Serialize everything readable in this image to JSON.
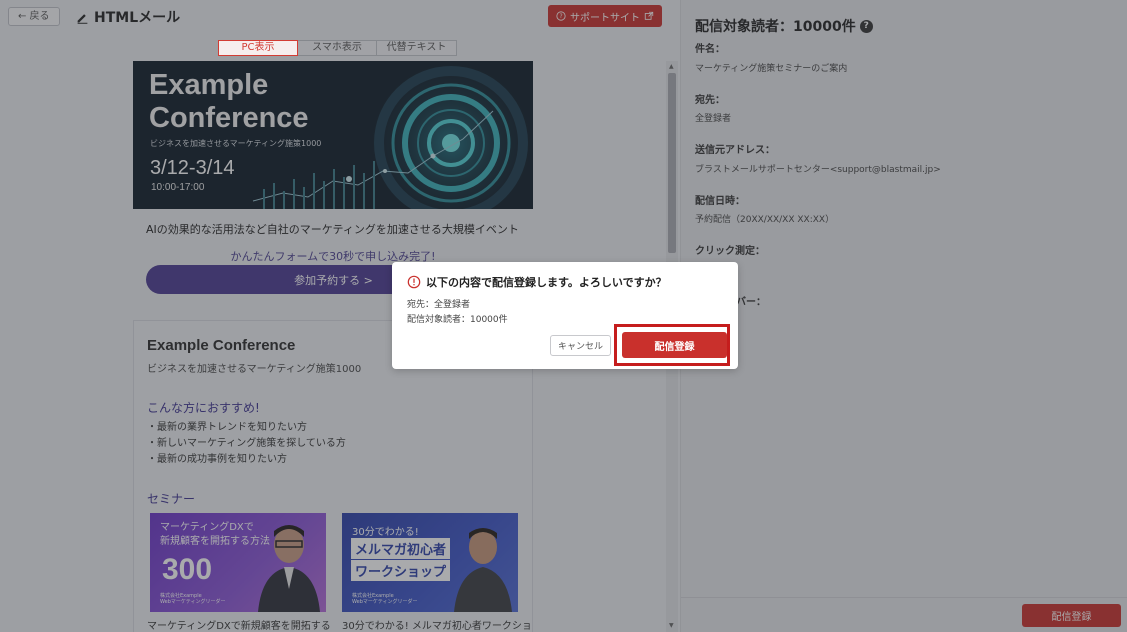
{
  "topbar": {
    "back_label": "← 戻る",
    "title": "HTMLメール",
    "support_label": "サポートサイト"
  },
  "view_tabs": [
    {
      "label": "PC表示",
      "active": true
    },
    {
      "label": "スマホ表示",
      "active": false
    },
    {
      "label": "代替テキスト",
      "active": false
    }
  ],
  "email": {
    "hero": {
      "title_line1": "Example",
      "title_line2": "Conference",
      "subtitle": "ビジネスを加速させるマーケティング施策1000",
      "date": "3/12-3/14",
      "time": "10:00-17:00"
    },
    "lead": "AIの効果的な活用法など自社のマーケティングを加速させる大規模イベント",
    "form_note": "かんたんフォームで30秒で申し込み完了!",
    "cta_label": "参加予約する >",
    "card": {
      "title": "Example Conference",
      "subtitle": "ビジネスを加速させるマーケティング施策1000",
      "recommend_heading": "こんな方におすすめ!",
      "recommend_items": [
        "・最新の業界トレンドを知りたい方",
        "・新しいマーケティング施策を探している方",
        "・最新の成功事例を知りたい方"
      ],
      "seminar_heading": "セミナー",
      "seminars": [
        {
          "line1": "マーケティングDXで",
          "line2": "新規顧客を開拓する方法",
          "big": "300",
          "company1": "株式会社Example",
          "company2": "Webマーケティングリーダー",
          "caption": "マーケティングDXで新規顧客を開拓する"
        },
        {
          "line1": "30分でわかる!",
          "line2": "メルマガ初心者",
          "line3": "ワークショップ",
          "company1": "株式会社Example",
          "company2": "Webマーケティングリーダー",
          "caption": "30分でわかる! メルマガ初心者ワークショ"
        }
      ]
    }
  },
  "summary": {
    "heading": "配信対象読者：10000件",
    "fields": [
      {
        "label": "件名：",
        "value": "マーケティング施策セミナーのご案内"
      },
      {
        "label": "宛先：",
        "value": "全登録者"
      },
      {
        "label": "送信元アドレス：",
        "value": "ブラストメールサポートセンター<support@blastmail.jp>"
      },
      {
        "label": "配信日時：",
        "value": "予約配信（20XX/XX/XX XX:XX）"
      },
      {
        "label": "クリック測定：",
        "value": ""
      },
      {
        "label": "バー：",
        "value": ""
      }
    ],
    "submit_label": "配信登録"
  },
  "dialog": {
    "title": "以下の内容で配信登録します。よろしいですか？",
    "line1": "宛先：全登録者",
    "line2": "配信対象読者：10000件",
    "cancel_label": "キャンセル",
    "confirm_label": "配信登録"
  },
  "colors": {
    "accent_red": "#c9302c",
    "brand_purple": "#4b3a92"
  }
}
